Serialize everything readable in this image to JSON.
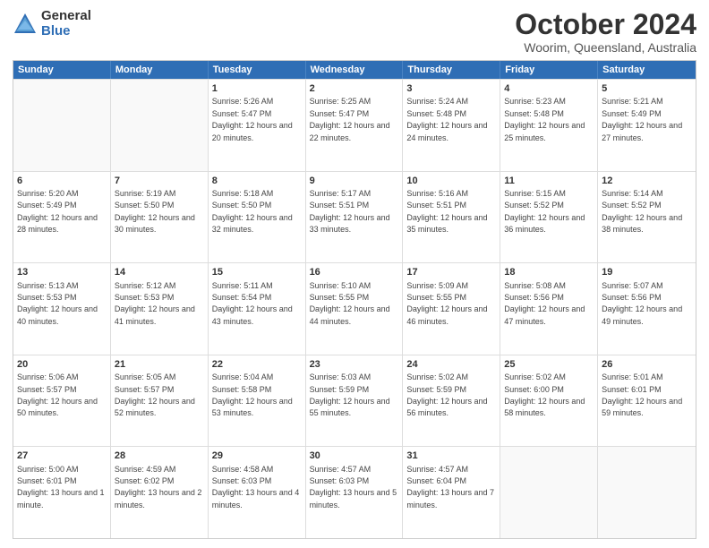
{
  "logo": {
    "general": "General",
    "blue": "Blue"
  },
  "title": "October 2024",
  "subtitle": "Woorim, Queensland, Australia",
  "days": [
    "Sunday",
    "Monday",
    "Tuesday",
    "Wednesday",
    "Thursday",
    "Friday",
    "Saturday"
  ],
  "weeks": [
    [
      {
        "day": "",
        "sunrise": "",
        "sunset": "",
        "daylight": ""
      },
      {
        "day": "",
        "sunrise": "",
        "sunset": "",
        "daylight": ""
      },
      {
        "day": "1",
        "sunrise": "Sunrise: 5:26 AM",
        "sunset": "Sunset: 5:47 PM",
        "daylight": "Daylight: 12 hours and 20 minutes."
      },
      {
        "day": "2",
        "sunrise": "Sunrise: 5:25 AM",
        "sunset": "Sunset: 5:47 PM",
        "daylight": "Daylight: 12 hours and 22 minutes."
      },
      {
        "day": "3",
        "sunrise": "Sunrise: 5:24 AM",
        "sunset": "Sunset: 5:48 PM",
        "daylight": "Daylight: 12 hours and 24 minutes."
      },
      {
        "day": "4",
        "sunrise": "Sunrise: 5:23 AM",
        "sunset": "Sunset: 5:48 PM",
        "daylight": "Daylight: 12 hours and 25 minutes."
      },
      {
        "day": "5",
        "sunrise": "Sunrise: 5:21 AM",
        "sunset": "Sunset: 5:49 PM",
        "daylight": "Daylight: 12 hours and 27 minutes."
      }
    ],
    [
      {
        "day": "6",
        "sunrise": "Sunrise: 5:20 AM",
        "sunset": "Sunset: 5:49 PM",
        "daylight": "Daylight: 12 hours and 28 minutes."
      },
      {
        "day": "7",
        "sunrise": "Sunrise: 5:19 AM",
        "sunset": "Sunset: 5:50 PM",
        "daylight": "Daylight: 12 hours and 30 minutes."
      },
      {
        "day": "8",
        "sunrise": "Sunrise: 5:18 AM",
        "sunset": "Sunset: 5:50 PM",
        "daylight": "Daylight: 12 hours and 32 minutes."
      },
      {
        "day": "9",
        "sunrise": "Sunrise: 5:17 AM",
        "sunset": "Sunset: 5:51 PM",
        "daylight": "Daylight: 12 hours and 33 minutes."
      },
      {
        "day": "10",
        "sunrise": "Sunrise: 5:16 AM",
        "sunset": "Sunset: 5:51 PM",
        "daylight": "Daylight: 12 hours and 35 minutes."
      },
      {
        "day": "11",
        "sunrise": "Sunrise: 5:15 AM",
        "sunset": "Sunset: 5:52 PM",
        "daylight": "Daylight: 12 hours and 36 minutes."
      },
      {
        "day": "12",
        "sunrise": "Sunrise: 5:14 AM",
        "sunset": "Sunset: 5:52 PM",
        "daylight": "Daylight: 12 hours and 38 minutes."
      }
    ],
    [
      {
        "day": "13",
        "sunrise": "Sunrise: 5:13 AM",
        "sunset": "Sunset: 5:53 PM",
        "daylight": "Daylight: 12 hours and 40 minutes."
      },
      {
        "day": "14",
        "sunrise": "Sunrise: 5:12 AM",
        "sunset": "Sunset: 5:53 PM",
        "daylight": "Daylight: 12 hours and 41 minutes."
      },
      {
        "day": "15",
        "sunrise": "Sunrise: 5:11 AM",
        "sunset": "Sunset: 5:54 PM",
        "daylight": "Daylight: 12 hours and 43 minutes."
      },
      {
        "day": "16",
        "sunrise": "Sunrise: 5:10 AM",
        "sunset": "Sunset: 5:55 PM",
        "daylight": "Daylight: 12 hours and 44 minutes."
      },
      {
        "day": "17",
        "sunrise": "Sunrise: 5:09 AM",
        "sunset": "Sunset: 5:55 PM",
        "daylight": "Daylight: 12 hours and 46 minutes."
      },
      {
        "day": "18",
        "sunrise": "Sunrise: 5:08 AM",
        "sunset": "Sunset: 5:56 PM",
        "daylight": "Daylight: 12 hours and 47 minutes."
      },
      {
        "day": "19",
        "sunrise": "Sunrise: 5:07 AM",
        "sunset": "Sunset: 5:56 PM",
        "daylight": "Daylight: 12 hours and 49 minutes."
      }
    ],
    [
      {
        "day": "20",
        "sunrise": "Sunrise: 5:06 AM",
        "sunset": "Sunset: 5:57 PM",
        "daylight": "Daylight: 12 hours and 50 minutes."
      },
      {
        "day": "21",
        "sunrise": "Sunrise: 5:05 AM",
        "sunset": "Sunset: 5:57 PM",
        "daylight": "Daylight: 12 hours and 52 minutes."
      },
      {
        "day": "22",
        "sunrise": "Sunrise: 5:04 AM",
        "sunset": "Sunset: 5:58 PM",
        "daylight": "Daylight: 12 hours and 53 minutes."
      },
      {
        "day": "23",
        "sunrise": "Sunrise: 5:03 AM",
        "sunset": "Sunset: 5:59 PM",
        "daylight": "Daylight: 12 hours and 55 minutes."
      },
      {
        "day": "24",
        "sunrise": "Sunrise: 5:02 AM",
        "sunset": "Sunset: 5:59 PM",
        "daylight": "Daylight: 12 hours and 56 minutes."
      },
      {
        "day": "25",
        "sunrise": "Sunrise: 5:02 AM",
        "sunset": "Sunset: 6:00 PM",
        "daylight": "Daylight: 12 hours and 58 minutes."
      },
      {
        "day": "26",
        "sunrise": "Sunrise: 5:01 AM",
        "sunset": "Sunset: 6:01 PM",
        "daylight": "Daylight: 12 hours and 59 minutes."
      }
    ],
    [
      {
        "day": "27",
        "sunrise": "Sunrise: 5:00 AM",
        "sunset": "Sunset: 6:01 PM",
        "daylight": "Daylight: 13 hours and 1 minute."
      },
      {
        "day": "28",
        "sunrise": "Sunrise: 4:59 AM",
        "sunset": "Sunset: 6:02 PM",
        "daylight": "Daylight: 13 hours and 2 minutes."
      },
      {
        "day": "29",
        "sunrise": "Sunrise: 4:58 AM",
        "sunset": "Sunset: 6:03 PM",
        "daylight": "Daylight: 13 hours and 4 minutes."
      },
      {
        "day": "30",
        "sunrise": "Sunrise: 4:57 AM",
        "sunset": "Sunset: 6:03 PM",
        "daylight": "Daylight: 13 hours and 5 minutes."
      },
      {
        "day": "31",
        "sunrise": "Sunrise: 4:57 AM",
        "sunset": "Sunset: 6:04 PM",
        "daylight": "Daylight: 13 hours and 7 minutes."
      },
      {
        "day": "",
        "sunrise": "",
        "sunset": "",
        "daylight": ""
      },
      {
        "day": "",
        "sunrise": "",
        "sunset": "",
        "daylight": ""
      }
    ]
  ]
}
